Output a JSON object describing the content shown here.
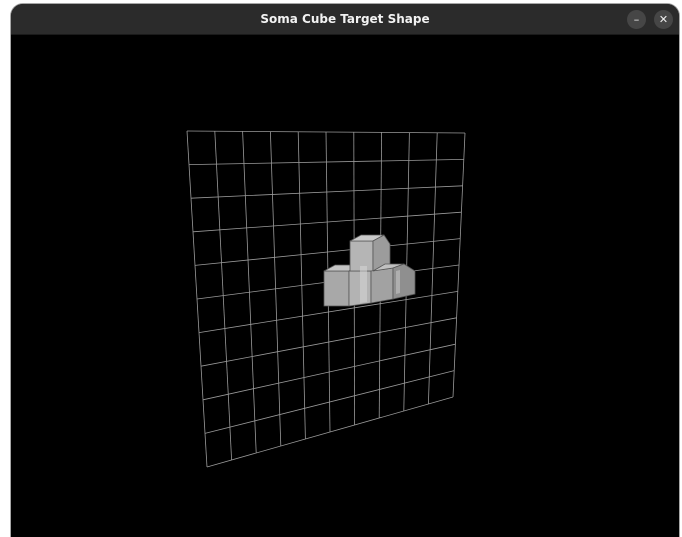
{
  "window": {
    "title": "Soma Cube Target Shape"
  },
  "titlebar": {
    "minimize_glyph": "–",
    "close_glyph": "✕",
    "minimize_icon": "minimize-icon",
    "close_icon": "close-icon"
  },
  "scene": {
    "grid_rows": 10,
    "grid_cols": 10,
    "colors": {
      "background": "#000000",
      "grid": "#9a9a9a",
      "cube_face_light": "#bdbdbd",
      "cube_face_mid": "#a6a6a6",
      "cube_face_dark": "#8a8a8a",
      "cube_edge": "#5a5a5a"
    }
  }
}
